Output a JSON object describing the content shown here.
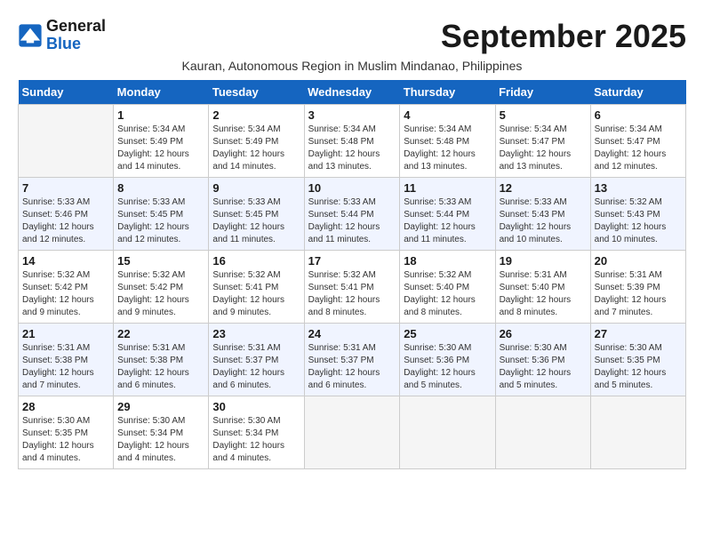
{
  "logo": {
    "line1": "General",
    "line2": "Blue"
  },
  "title": "September 2025",
  "subtitle": "Kauran, Autonomous Region in Muslim Mindanao, Philippines",
  "days_of_week": [
    "Sunday",
    "Monday",
    "Tuesday",
    "Wednesday",
    "Thursday",
    "Friday",
    "Saturday"
  ],
  "weeks": [
    [
      {
        "num": "",
        "detail": ""
      },
      {
        "num": "1",
        "detail": "Sunrise: 5:34 AM\nSunset: 5:49 PM\nDaylight: 12 hours\nand 14 minutes."
      },
      {
        "num": "2",
        "detail": "Sunrise: 5:34 AM\nSunset: 5:49 PM\nDaylight: 12 hours\nand 14 minutes."
      },
      {
        "num": "3",
        "detail": "Sunrise: 5:34 AM\nSunset: 5:48 PM\nDaylight: 12 hours\nand 13 minutes."
      },
      {
        "num": "4",
        "detail": "Sunrise: 5:34 AM\nSunset: 5:48 PM\nDaylight: 12 hours\nand 13 minutes."
      },
      {
        "num": "5",
        "detail": "Sunrise: 5:34 AM\nSunset: 5:47 PM\nDaylight: 12 hours\nand 13 minutes."
      },
      {
        "num": "6",
        "detail": "Sunrise: 5:34 AM\nSunset: 5:47 PM\nDaylight: 12 hours\nand 12 minutes."
      }
    ],
    [
      {
        "num": "7",
        "detail": "Sunrise: 5:33 AM\nSunset: 5:46 PM\nDaylight: 12 hours\nand 12 minutes."
      },
      {
        "num": "8",
        "detail": "Sunrise: 5:33 AM\nSunset: 5:45 PM\nDaylight: 12 hours\nand 12 minutes."
      },
      {
        "num": "9",
        "detail": "Sunrise: 5:33 AM\nSunset: 5:45 PM\nDaylight: 12 hours\nand 11 minutes."
      },
      {
        "num": "10",
        "detail": "Sunrise: 5:33 AM\nSunset: 5:44 PM\nDaylight: 12 hours\nand 11 minutes."
      },
      {
        "num": "11",
        "detail": "Sunrise: 5:33 AM\nSunset: 5:44 PM\nDaylight: 12 hours\nand 11 minutes."
      },
      {
        "num": "12",
        "detail": "Sunrise: 5:33 AM\nSunset: 5:43 PM\nDaylight: 12 hours\nand 10 minutes."
      },
      {
        "num": "13",
        "detail": "Sunrise: 5:32 AM\nSunset: 5:43 PM\nDaylight: 12 hours\nand 10 minutes."
      }
    ],
    [
      {
        "num": "14",
        "detail": "Sunrise: 5:32 AM\nSunset: 5:42 PM\nDaylight: 12 hours\nand 9 minutes."
      },
      {
        "num": "15",
        "detail": "Sunrise: 5:32 AM\nSunset: 5:42 PM\nDaylight: 12 hours\nand 9 minutes."
      },
      {
        "num": "16",
        "detail": "Sunrise: 5:32 AM\nSunset: 5:41 PM\nDaylight: 12 hours\nand 9 minutes."
      },
      {
        "num": "17",
        "detail": "Sunrise: 5:32 AM\nSunset: 5:41 PM\nDaylight: 12 hours\nand 8 minutes."
      },
      {
        "num": "18",
        "detail": "Sunrise: 5:32 AM\nSunset: 5:40 PM\nDaylight: 12 hours\nand 8 minutes."
      },
      {
        "num": "19",
        "detail": "Sunrise: 5:31 AM\nSunset: 5:40 PM\nDaylight: 12 hours\nand 8 minutes."
      },
      {
        "num": "20",
        "detail": "Sunrise: 5:31 AM\nSunset: 5:39 PM\nDaylight: 12 hours\nand 7 minutes."
      }
    ],
    [
      {
        "num": "21",
        "detail": "Sunrise: 5:31 AM\nSunset: 5:38 PM\nDaylight: 12 hours\nand 7 minutes."
      },
      {
        "num": "22",
        "detail": "Sunrise: 5:31 AM\nSunset: 5:38 PM\nDaylight: 12 hours\nand 6 minutes."
      },
      {
        "num": "23",
        "detail": "Sunrise: 5:31 AM\nSunset: 5:37 PM\nDaylight: 12 hours\nand 6 minutes."
      },
      {
        "num": "24",
        "detail": "Sunrise: 5:31 AM\nSunset: 5:37 PM\nDaylight: 12 hours\nand 6 minutes."
      },
      {
        "num": "25",
        "detail": "Sunrise: 5:30 AM\nSunset: 5:36 PM\nDaylight: 12 hours\nand 5 minutes."
      },
      {
        "num": "26",
        "detail": "Sunrise: 5:30 AM\nSunset: 5:36 PM\nDaylight: 12 hours\nand 5 minutes."
      },
      {
        "num": "27",
        "detail": "Sunrise: 5:30 AM\nSunset: 5:35 PM\nDaylight: 12 hours\nand 5 minutes."
      }
    ],
    [
      {
        "num": "28",
        "detail": "Sunrise: 5:30 AM\nSunset: 5:35 PM\nDaylight: 12 hours\nand 4 minutes."
      },
      {
        "num": "29",
        "detail": "Sunrise: 5:30 AM\nSunset: 5:34 PM\nDaylight: 12 hours\nand 4 minutes."
      },
      {
        "num": "30",
        "detail": "Sunrise: 5:30 AM\nSunset: 5:34 PM\nDaylight: 12 hours\nand 4 minutes."
      },
      {
        "num": "",
        "detail": ""
      },
      {
        "num": "",
        "detail": ""
      },
      {
        "num": "",
        "detail": ""
      },
      {
        "num": "",
        "detail": ""
      }
    ]
  ]
}
